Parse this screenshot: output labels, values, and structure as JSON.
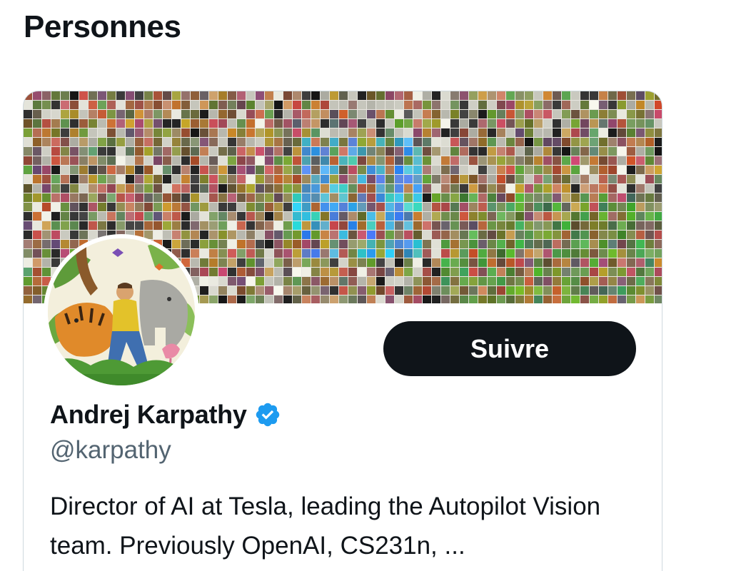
{
  "section": {
    "title": "Personnes"
  },
  "user_card": {
    "display_name": "Andrej Karpathy",
    "handle": "@karpathy",
    "verified": true,
    "bio": "Director of AI at Tesla, leading the Autopilot Vision team. Previously OpenAI, CS231n, ...",
    "follow_label": "Suivre",
    "banner_image": "mosaic-of-image-thumbnails",
    "avatar_image": "illustration-person-with-tiger-and-elephant"
  },
  "colors": {
    "text_primary": "#0f1419",
    "text_secondary": "#536471",
    "follow_button_bg": "#0f1419",
    "follow_button_text": "#ffffff",
    "verified_badge": "#1d9bf0",
    "card_border": "#cfd9de"
  }
}
